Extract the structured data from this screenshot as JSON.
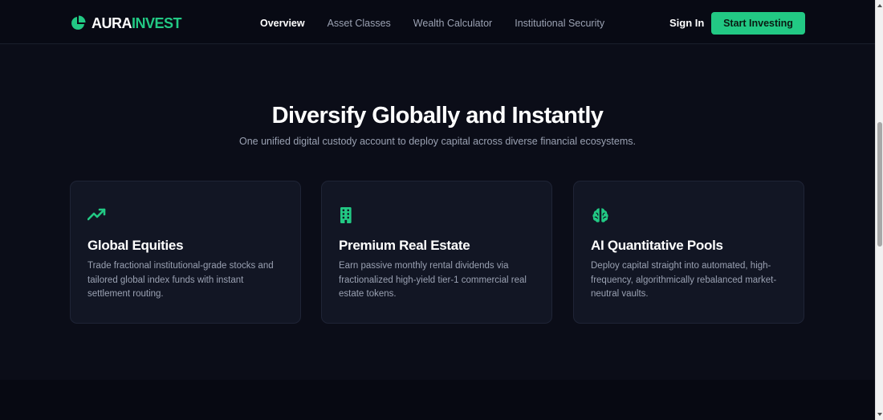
{
  "brand": {
    "name_part1": "AURA",
    "name_part2": "INVEST",
    "icon": "pie-chart-icon",
    "accent_color": "#22c984"
  },
  "nav": {
    "links": [
      {
        "label": "Overview",
        "active": true
      },
      {
        "label": "Asset Classes",
        "active": false
      },
      {
        "label": "Wealth Calculator",
        "active": false
      },
      {
        "label": "Institutional Security",
        "active": false
      }
    ],
    "sign_in": "Sign In",
    "cta": "Start Investing"
  },
  "section": {
    "title": "Diversify Globally and Instantly",
    "subtitle": "One unified digital custody account to deploy capital across diverse financial ecosystems."
  },
  "cards": [
    {
      "icon": "trending-up-icon",
      "title": "Global Equities",
      "text": "Trade fractional institutional-grade stocks and tailored global index funds with instant settlement routing."
    },
    {
      "icon": "building-icon",
      "title": "Premium Real Estate",
      "text": "Earn passive monthly rental dividends via fractionalized high-yield tier-1 commercial real estate tokens."
    },
    {
      "icon": "brain-icon",
      "title": "AI Quantitative Pools",
      "text": "Deploy capital straight into automated, high-frequency, algorithmically rebalanced market-neutral vaults."
    }
  ],
  "colors": {
    "background": "#0b0d18",
    "card_background": "#121624",
    "muted_text": "#9aa1b2"
  }
}
